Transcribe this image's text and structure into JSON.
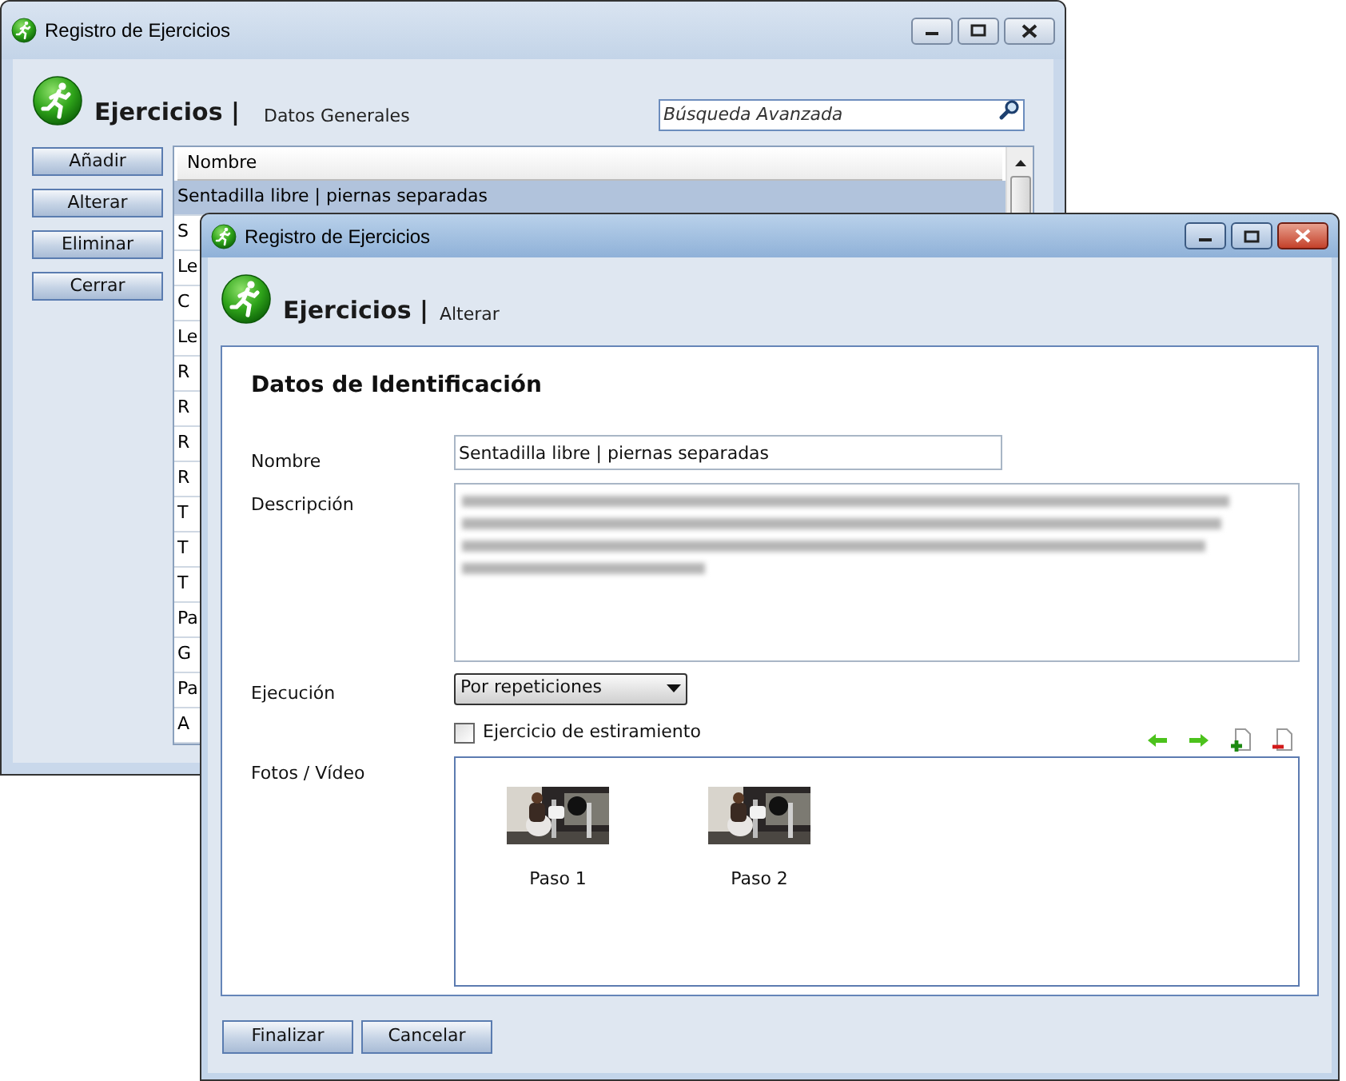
{
  "back_window": {
    "title": "Registro de Ejercicios",
    "active": false,
    "heading": "Ejercicios |",
    "section": "Datos Generales",
    "search": {
      "placeholder": "Búsqueda Avanzada"
    },
    "buttons": [
      "Añadir",
      "Alterar",
      "Eliminar",
      "Cerrar"
    ],
    "table": {
      "columns": [
        "Nombre"
      ],
      "rows": [
        {
          "name": "Sentadilla libre | piernas separadas",
          "selected": true
        },
        {
          "name": "S",
          "selected": false
        },
        {
          "name": "Le",
          "selected": false
        },
        {
          "name": "C",
          "selected": false
        },
        {
          "name": "Le",
          "selected": false
        },
        {
          "name": "R",
          "selected": false
        },
        {
          "name": "R",
          "selected": false
        },
        {
          "name": "R",
          "selected": false
        },
        {
          "name": "R",
          "selected": false
        },
        {
          "name": "T",
          "selected": false
        },
        {
          "name": "T",
          "selected": false
        },
        {
          "name": "T",
          "selected": false
        },
        {
          "name": "Pa",
          "selected": false
        },
        {
          "name": "G",
          "selected": false
        },
        {
          "name": "Pa",
          "selected": false
        },
        {
          "name": "A",
          "selected": false
        }
      ]
    }
  },
  "front_window": {
    "title": "Registro de Ejercicios",
    "active": true,
    "heading": "Ejercicios |",
    "section": "Alterar",
    "form_title": "Datos de Identificación",
    "name_field": {
      "label": "Nombre",
      "value": "Sentadilla libre | piernas separadas"
    },
    "description_field": {
      "label": "Descripción"
    },
    "execution_field": {
      "label": "Ejecución",
      "value": "Por repeticiones"
    },
    "stretch_checkbox": {
      "label": "Ejercicio de estiramiento",
      "checked": false
    },
    "media": {
      "label": "Fotos / Vídeo",
      "items": [
        {
          "caption": "Paso 1",
          "kind": "picture"
        },
        {
          "caption": "Paso 2",
          "kind": "picture"
        }
      ]
    },
    "buttons": [
      "Finalizar",
      "Cancelar"
    ]
  }
}
